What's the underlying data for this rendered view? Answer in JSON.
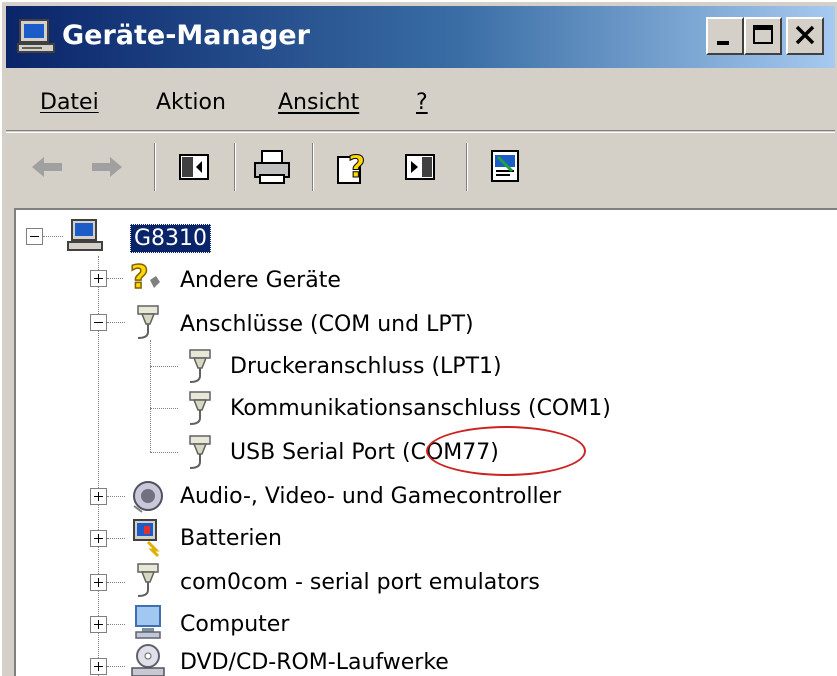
{
  "window": {
    "title": "Geräte-Manager",
    "title_icon": "device-manager-icon",
    "controls": [
      "minimize-icon",
      "maximize-icon",
      "close-icon"
    ]
  },
  "menu": {
    "items": [
      {
        "label": "Datei"
      },
      {
        "label": "Aktion"
      },
      {
        "label": "Ansicht"
      },
      {
        "label": "?"
      }
    ]
  },
  "toolbar": {
    "buttons": [
      "back-arrow-icon",
      "forward-arrow-icon",
      "show-hide-console-tree-icon",
      "print-icon",
      "help-icon",
      "show-hide-action-pane-icon",
      "device-properties-icon"
    ]
  },
  "tree": {
    "root": {
      "label": "G8310",
      "icon": "computer-icon"
    },
    "nodes": [
      {
        "label": "Andere Geräte",
        "icon": "unknown-device-icon",
        "expanded": false
      },
      {
        "label": "Anschlüsse (COM und LPT)",
        "icon": "port-connector-icon",
        "expanded": true
      },
      {
        "label": "Druckeranschluss (LPT1)",
        "icon": "port-connector-icon",
        "child": true
      },
      {
        "label": "Kommunikationsanschluss (COM1)",
        "icon": "port-connector-icon",
        "child": true
      },
      {
        "label": "USB Serial Port (COM77)",
        "icon": "port-connector-icon",
        "child": true
      },
      {
        "label": "Audio-, Video- und Gamecontroller",
        "icon": "speaker-icon",
        "expanded": false
      },
      {
        "label": "Batterien",
        "icon": "battery-icon",
        "expanded": false
      },
      {
        "label": "com0com - serial port emulators",
        "icon": "port-connector-icon",
        "expanded": false
      },
      {
        "label": "Computer",
        "icon": "monitor-icon",
        "expanded": false
      },
      {
        "label": "DVD/CD-ROM-Laufwerke",
        "icon": "cd-drive-icon",
        "expanded": false
      }
    ]
  },
  "colors": {
    "title_gradient_start": "#0a246a",
    "title_gradient_end": "#a6caf0",
    "selection": "#0a246a",
    "annotation_ring": "#cc2222",
    "face": "#d4d0c8"
  }
}
